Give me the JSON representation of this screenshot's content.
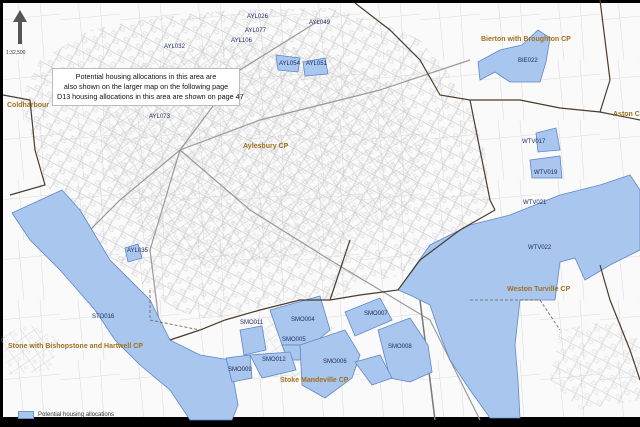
{
  "map": {
    "colors": {
      "background": "#fafafa",
      "allocation_fill": "#a9c6ee",
      "allocation_stroke": "#5f87c9",
      "parish_boundary": "#4a3b2b",
      "road_lines": "#bdbdbd",
      "parish_label": "#a07020",
      "site_label": "#1f2e66"
    },
    "notice": {
      "line1": "Potential housing allocations in this area are",
      "line2": "also shown on the larger map on the following page",
      "line3": "D13 housing allocations in this area are shown on page 47"
    },
    "scale_text": "1:32,500",
    "parishes": {
      "bierton": "Bierton with Broughton CP",
      "coldharbour": "Coldharbour",
      "aston": "Aston C",
      "aylesbury": "Aylesbury CP",
      "weston_turville": "Weston Turville CP",
      "stone": "Stone with Bishopstone and Hartwell CP",
      "stoke_mandeville": "Stoke Mandeville CP"
    },
    "sites": {
      "ayl026": "AYL026",
      "ayl049": "AYL049",
      "ayl077": "AYL077",
      "ayl106": "AYL106",
      "ayl032": "AYL032",
      "ayl054": "AYL054",
      "ayl051": "AYL051",
      "ayl073": "AYL073",
      "ayl035": "AYL035",
      "bie022": "BIE022",
      "wtv017": "WTV017",
      "wtv019": "WTV019",
      "wtv021": "WTV021",
      "wtv022": "WTV022",
      "sto016": "STO016",
      "smo011": "SMO011",
      "smo004": "SMO004",
      "smo005": "SMO005",
      "smo007": "SMO007",
      "smo008": "SMO008",
      "smo012": "SMO012",
      "smo006": "SMO006",
      "smo009": "SMO009"
    },
    "legend": {
      "label": "Potential housing allocations"
    }
  }
}
